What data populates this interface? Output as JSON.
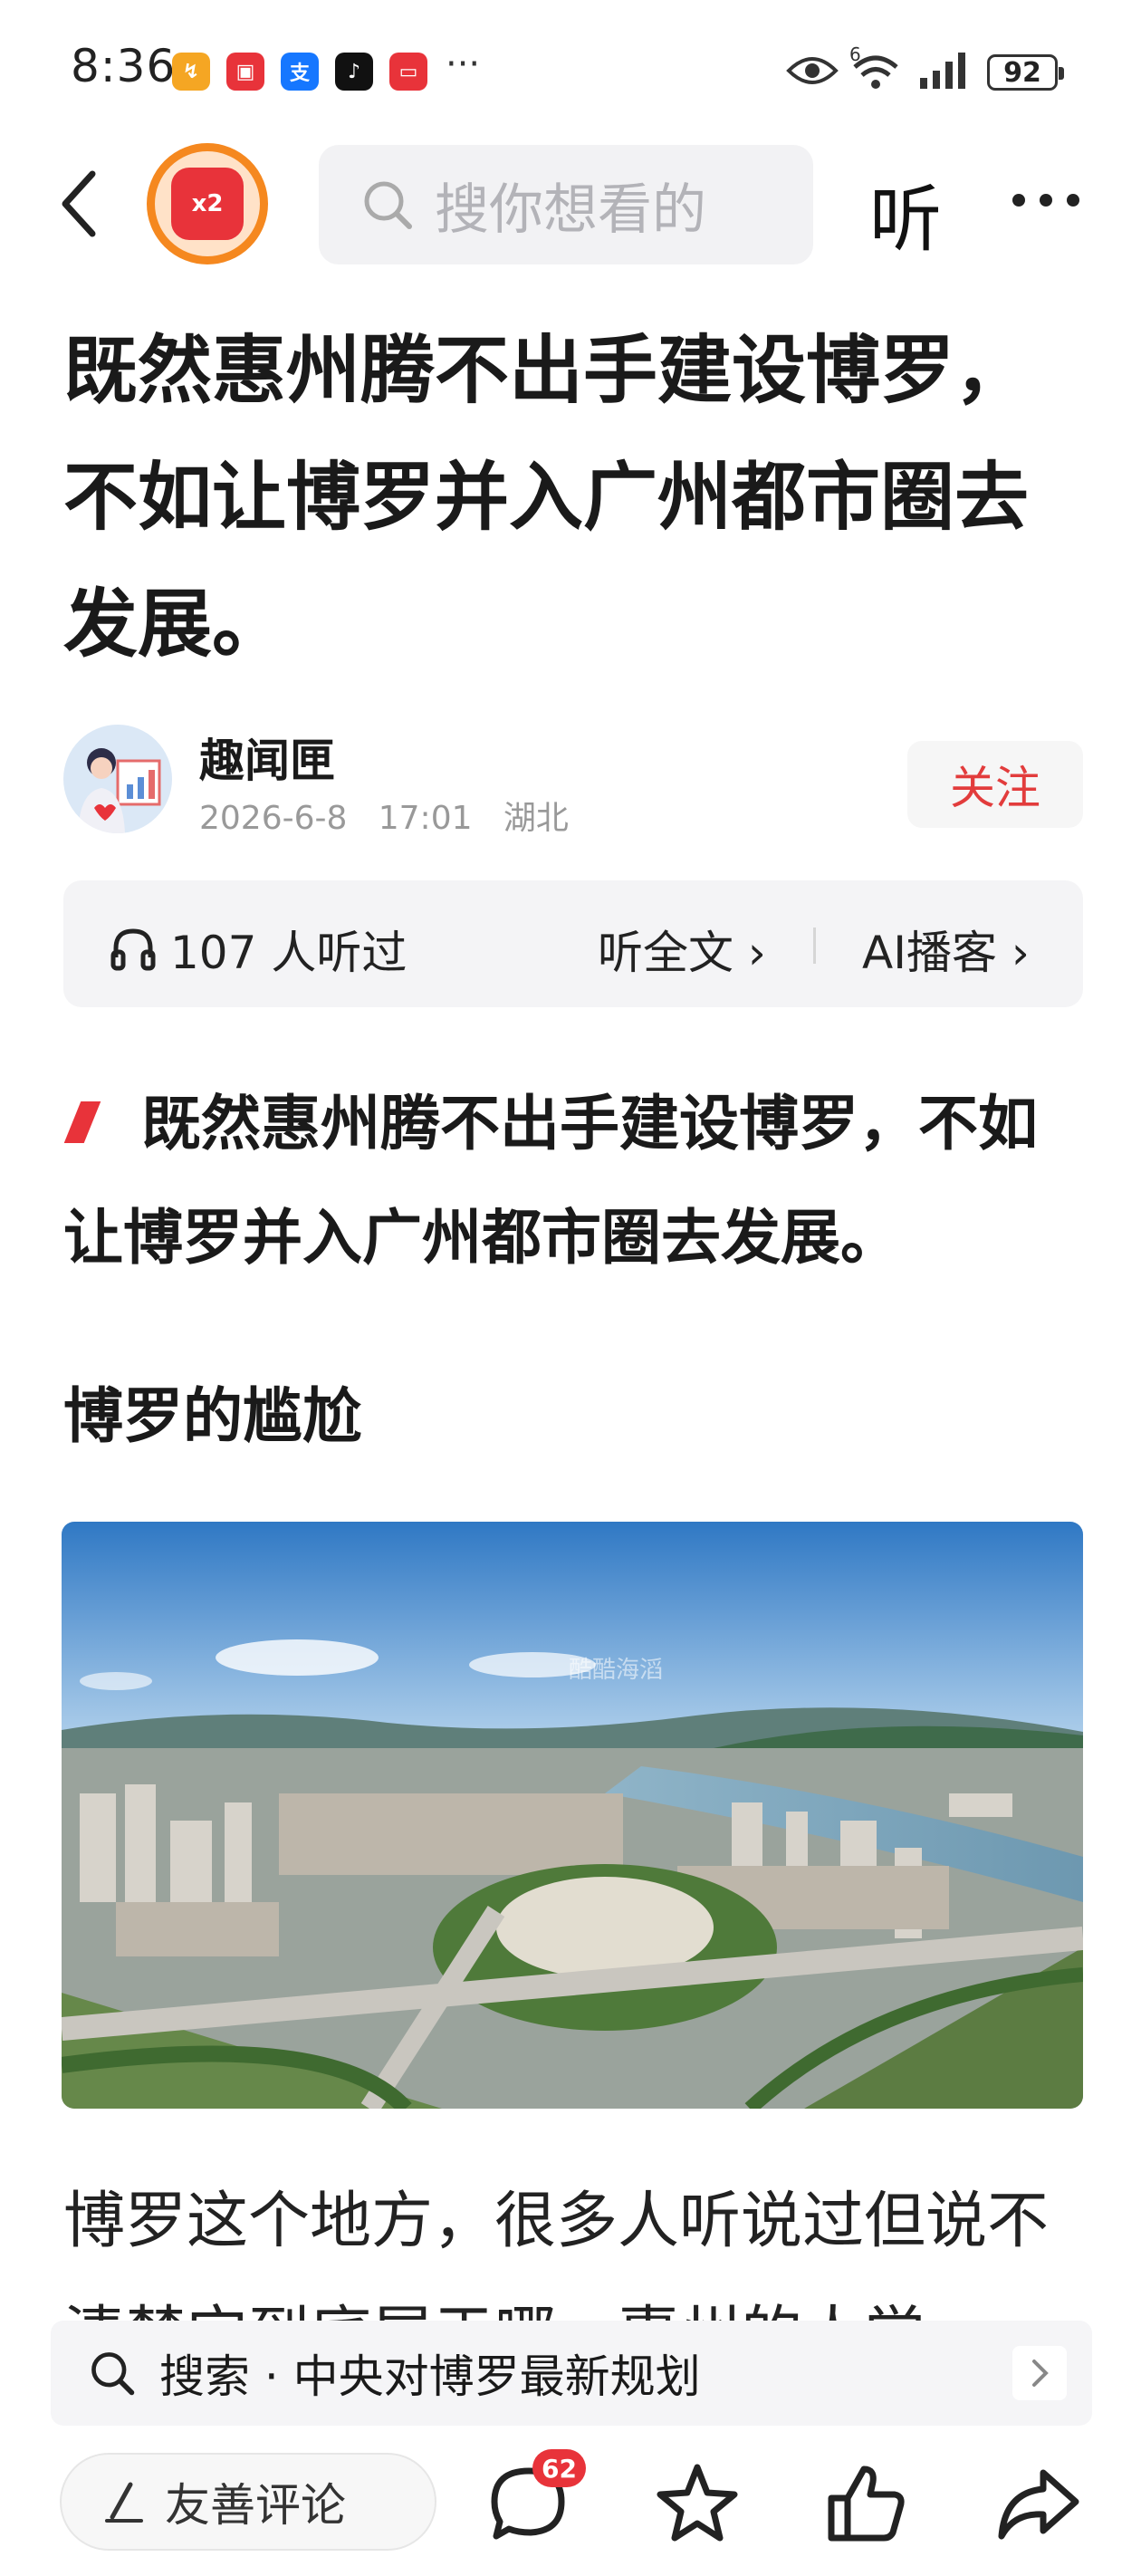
{
  "status_bar": {
    "time": "8:36",
    "apps": [
      {
        "name": "deal-app-icon",
        "glyph": "↯",
        "color": "#f5a623"
      },
      {
        "name": "huawei-app-icon",
        "glyph": "▣",
        "color": "#e8333a"
      },
      {
        "name": "alipay-app-icon",
        "glyph": "支",
        "color": "#1677ff"
      },
      {
        "name": "tiktok-app-icon",
        "glyph": "♪",
        "color": "#111111"
      },
      {
        "name": "video-app-icon",
        "glyph": "▭",
        "color": "#e8333a"
      }
    ],
    "more": "···",
    "network": "6",
    "battery": "92"
  },
  "nav": {
    "redpacket_label": "x2",
    "search_placeholder": "搜你想看的",
    "listen_label": "听"
  },
  "article": {
    "title": "既然惠州腾不出手建设博罗，不如让博罗并入广州都市圈去发展。",
    "author": "趣闻匣",
    "date": "2026-6-8",
    "time": "17:01",
    "location": "湖北",
    "follow_label": "关注",
    "listen_count": "107 人听过",
    "listen_full": "听全文",
    "ai_podcast": "AI播客",
    "lead": "既然惠州腾不出手建设博罗，不如让博罗并入广州都市圈去发展。",
    "section_heading": "博罗的尴尬",
    "watermark": "酷酷海滔",
    "paragraph": "博罗这个地方，很多人听说过但说不清楚它到底属于哪，惠州的人觉"
  },
  "search_suggestion": {
    "label": "搜索 · 中央对博罗最新规划"
  },
  "bottom_bar": {
    "comment_placeholder": "友善评论",
    "comment_count": "62"
  },
  "colors": {
    "accent_red": "#e8333a",
    "follow_red": "#e23c3c",
    "badge_orange": "#f5881f"
  }
}
